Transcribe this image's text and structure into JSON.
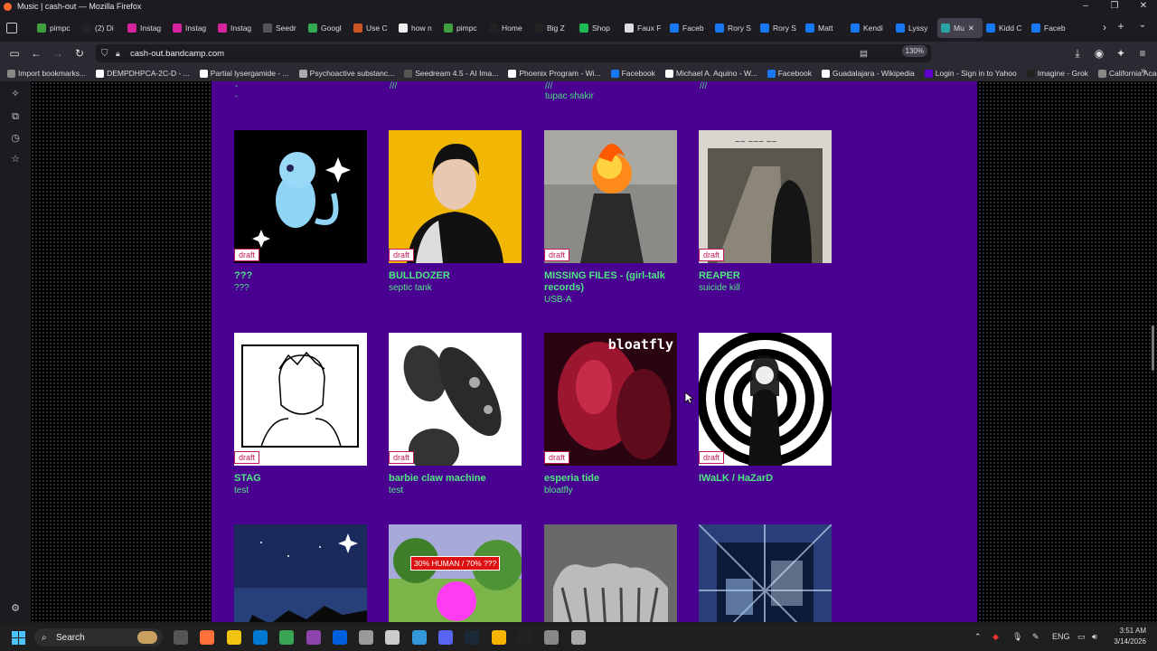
{
  "window": {
    "title": "Music | cash-out — Mozilla Firefox"
  },
  "tabs": [
    {
      "label": "pimpc",
      "color": "#3f9e3f"
    },
    {
      "label": "(2) Di",
      "color": "#222"
    },
    {
      "label": "Instag",
      "color": "#d6249f"
    },
    {
      "label": "Instag",
      "color": "#d6249f"
    },
    {
      "label": "Instag",
      "color": "#d6249f"
    },
    {
      "label": "Seedr",
      "color": "#555"
    },
    {
      "label": "Googl",
      "color": "#34a853"
    },
    {
      "label": "Use C",
      "color": "#c52"
    },
    {
      "label": "how n",
      "color": "#eee"
    },
    {
      "label": "pimpc",
      "color": "#3f9e3f"
    },
    {
      "label": "Home",
      "color": "#222"
    },
    {
      "label": "Big Z",
      "color": "#222"
    },
    {
      "label": "Shop",
      "color": "#1db954"
    },
    {
      "label": "Faux F",
      "color": "#ddd"
    },
    {
      "label": "Faceb",
      "color": "#1877f2"
    },
    {
      "label": "Rory S",
      "color": "#1877f2"
    },
    {
      "label": "Rory S",
      "color": "#1877f2"
    },
    {
      "label": "Matt",
      "color": "#1877f2"
    },
    {
      "label": "Kendi",
      "color": "#1877f2"
    },
    {
      "label": "Lyssy",
      "color": "#1877f2"
    },
    {
      "label": "Mu",
      "color": "#29a3a3",
      "active": true
    },
    {
      "label": "Kidd C",
      "color": "#1877f2"
    },
    {
      "label": "Faceb",
      "color": "#1877f2"
    }
  ],
  "navbar": {
    "url": "cash-out.bandcamp.com",
    "zoom": "130%"
  },
  "bookmarks": [
    {
      "label": "Import bookmarks...",
      "color": "#888"
    },
    {
      "label": "DEMPDHPCA-2C-D - ...",
      "color": "#fff"
    },
    {
      "label": "Partial lysergamide - ...",
      "color": "#fff"
    },
    {
      "label": "Psychoactive substanc...",
      "color": "#aaa"
    },
    {
      "label": "Seedream 4.5 - AI Ima...",
      "color": "#555"
    },
    {
      "label": "Phoenix Program - Wi...",
      "color": "#fff"
    },
    {
      "label": "Facebook",
      "color": "#1877f2"
    },
    {
      "label": "Michael A. Aquino - W...",
      "color": "#fff"
    },
    {
      "label": "Facebook",
      "color": "#1877f2"
    },
    {
      "label": "Guadalajara - Wikipedia",
      "color": "#fff"
    },
    {
      "label": "Login - Sign in to Yahoo",
      "color": "#6001d2"
    },
    {
      "label": "Imagine - Grok",
      "color": "#222"
    },
    {
      "label": "California Academy of...",
      "color": "#888"
    }
  ],
  "prev_row": [
    {
      "text": "-",
      "text2": "-"
    },
    {
      "text": "///",
      "text2": ""
    },
    {
      "text": "///",
      "text2": "tupac shakir"
    },
    {
      "text": "///",
      "text2": ""
    }
  ],
  "albums": [
    {
      "title": "???",
      "artist": "???",
      "draft": "draft",
      "art": "mew"
    },
    {
      "title": "BULLDOZER",
      "artist": "septic tank",
      "draft": "draft",
      "art": "bulldozer"
    },
    {
      "title": "MISSING FILES - (girl-talk records)",
      "artist": "USB-A",
      "draft": "draft",
      "art": "fire"
    },
    {
      "title": "REAPER",
      "artist": "suicide kill",
      "draft": "draft",
      "art": "reaper"
    },
    {
      "title": "STAG",
      "artist": "test",
      "draft": "draft",
      "art": "sketch"
    },
    {
      "title": "barbie claw machine",
      "artist": "test",
      "draft": "draft",
      "art": "cells"
    },
    {
      "title": "esperia tide",
      "artist": "bloatfly",
      "draft": "draft",
      "art": "bloatfly",
      "art_text": "bloatfly"
    },
    {
      "title": "IWaLK / HaZarD",
      "artist": "",
      "draft": "draft",
      "art": "spiral"
    },
    {
      "title": "",
      "artist": "",
      "draft": "",
      "art": "night"
    },
    {
      "title": "",
      "artist": "",
      "draft": "",
      "art": "park",
      "art_text": "30% HUMAN / 70% ???"
    },
    {
      "title": "",
      "artist": "",
      "draft": "",
      "art": "xray"
    },
    {
      "title": "",
      "artist": "",
      "draft": "",
      "art": "glass"
    }
  ],
  "taskbar": {
    "search": "Search",
    "time": "3:51 AM",
    "date": "3/14/2026",
    "lang": "ENG"
  }
}
